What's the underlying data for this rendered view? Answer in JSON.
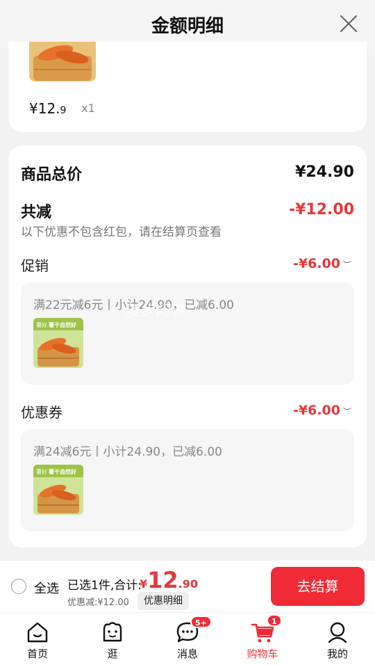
{
  "header": {
    "title": "金额明细"
  },
  "item_preview": {
    "price_int": "¥12.",
    "price_dec": "9",
    "qty": "x1"
  },
  "summary": {
    "total_label": "商品总价",
    "total_value": "¥24.90",
    "reduce_label": "共减",
    "reduce_value": "-¥12.00",
    "note": "以下优惠不包含红包，请在结算页查看"
  },
  "promotion": {
    "label": "促销",
    "value": "-¥6.00",
    "detail": "满22元减6元丨小计24.90，已减6.00"
  },
  "coupon": {
    "label": "优惠券",
    "value": "-¥6.00",
    "detail": "满24减6元丨小计24.90，已减6.00"
  },
  "watermark": "漫步闲游",
  "product_thumb": {
    "tag_left": "薯好",
    "tag_main": "薯干自然好"
  },
  "bottom_bar": {
    "select_all": "全选",
    "selected_text": "已选1件,合计:",
    "price_yen": "¥",
    "price_int": "12",
    "price_dec": ".90",
    "discount_line": "优惠减:¥12.00",
    "detail_button": "优惠明细",
    "checkout_button": "去结算"
  },
  "tabbar": {
    "tabs": [
      {
        "label": "首页",
        "icon": "home-icon"
      },
      {
        "label": "逛",
        "icon": "face-icon"
      },
      {
        "label": "消息",
        "icon": "message-icon",
        "badge": "5+"
      },
      {
        "label": "购物车",
        "icon": "cart-icon",
        "badge": "1",
        "active": true
      },
      {
        "label": "我的",
        "icon": "user-icon"
      }
    ]
  },
  "colors": {
    "accent": "#e4393c",
    "button": "#f02b36"
  }
}
